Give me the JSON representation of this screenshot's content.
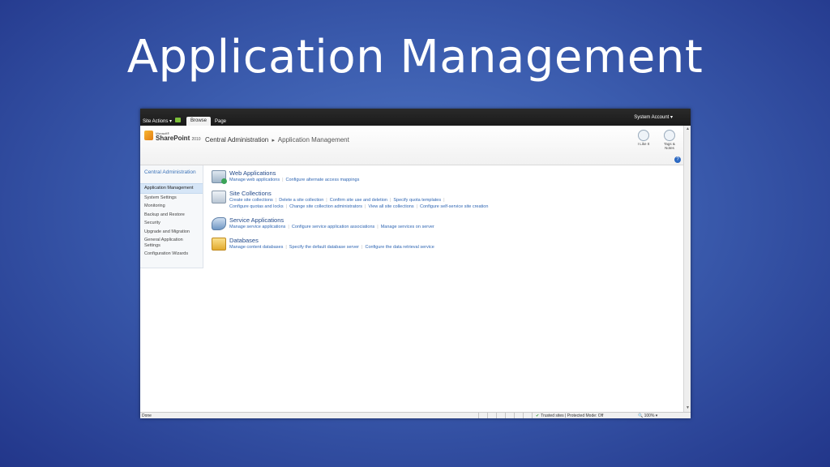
{
  "slide": {
    "title": "Application Management"
  },
  "ribbon": {
    "site_actions": "Site Actions ▾",
    "tabs": [
      {
        "label": "Browse",
        "active": true
      },
      {
        "label": "Page",
        "active": false
      }
    ],
    "account": "System Account ▾"
  },
  "header": {
    "logo_ms": "Microsoft®",
    "logo_product": "SharePoint",
    "logo_version": "2010",
    "breadcrumb": {
      "root": "Central Administration",
      "separator": "▸",
      "current": "Application Management"
    },
    "actions": [
      {
        "label": "I Like It",
        "icon": "thumbs-up-icon"
      },
      {
        "label": "Tags & Notes",
        "icon": "tag-icon"
      }
    ],
    "help": "?"
  },
  "quicklaunch": {
    "heading": "Central Administration",
    "items": [
      {
        "label": "Application Management",
        "active": true
      },
      {
        "label": "System Settings"
      },
      {
        "label": "Monitoring"
      },
      {
        "label": "Backup and Restore"
      },
      {
        "label": "Security"
      },
      {
        "label": "Upgrade and Migration"
      },
      {
        "label": "General Application Settings"
      },
      {
        "label": "Configuration Wizards"
      }
    ]
  },
  "sections": [
    {
      "title": "Web Applications",
      "icon": "web-applications-icon",
      "lines": [
        [
          "Manage web applications",
          "Configure alternate access mappings"
        ]
      ]
    },
    {
      "title": "Site Collections",
      "icon": "site-collections-icon",
      "lines": [
        [
          "Create site collections",
          "Delete a site collection",
          "Confirm site use and deletion",
          "Specify quota templates",
          ""
        ],
        [
          "Configure quotas and locks",
          "Change site collection administrators",
          "View all site collections",
          "Configure self-service site creation"
        ]
      ]
    },
    {
      "title": "Service Applications",
      "icon": "service-applications-icon",
      "lines": [
        [
          "Manage service applications",
          "Configure service application associations",
          "Manage services on server"
        ]
      ]
    },
    {
      "title": "Databases",
      "icon": "databases-icon",
      "lines": [
        [
          "Manage content databases",
          "Specify the default database server",
          "Configure the data retrieval service"
        ]
      ]
    }
  ],
  "statusbar": {
    "status": "Done",
    "zone": "Trusted sites | Protected Mode: Off",
    "zoom": "100%"
  }
}
